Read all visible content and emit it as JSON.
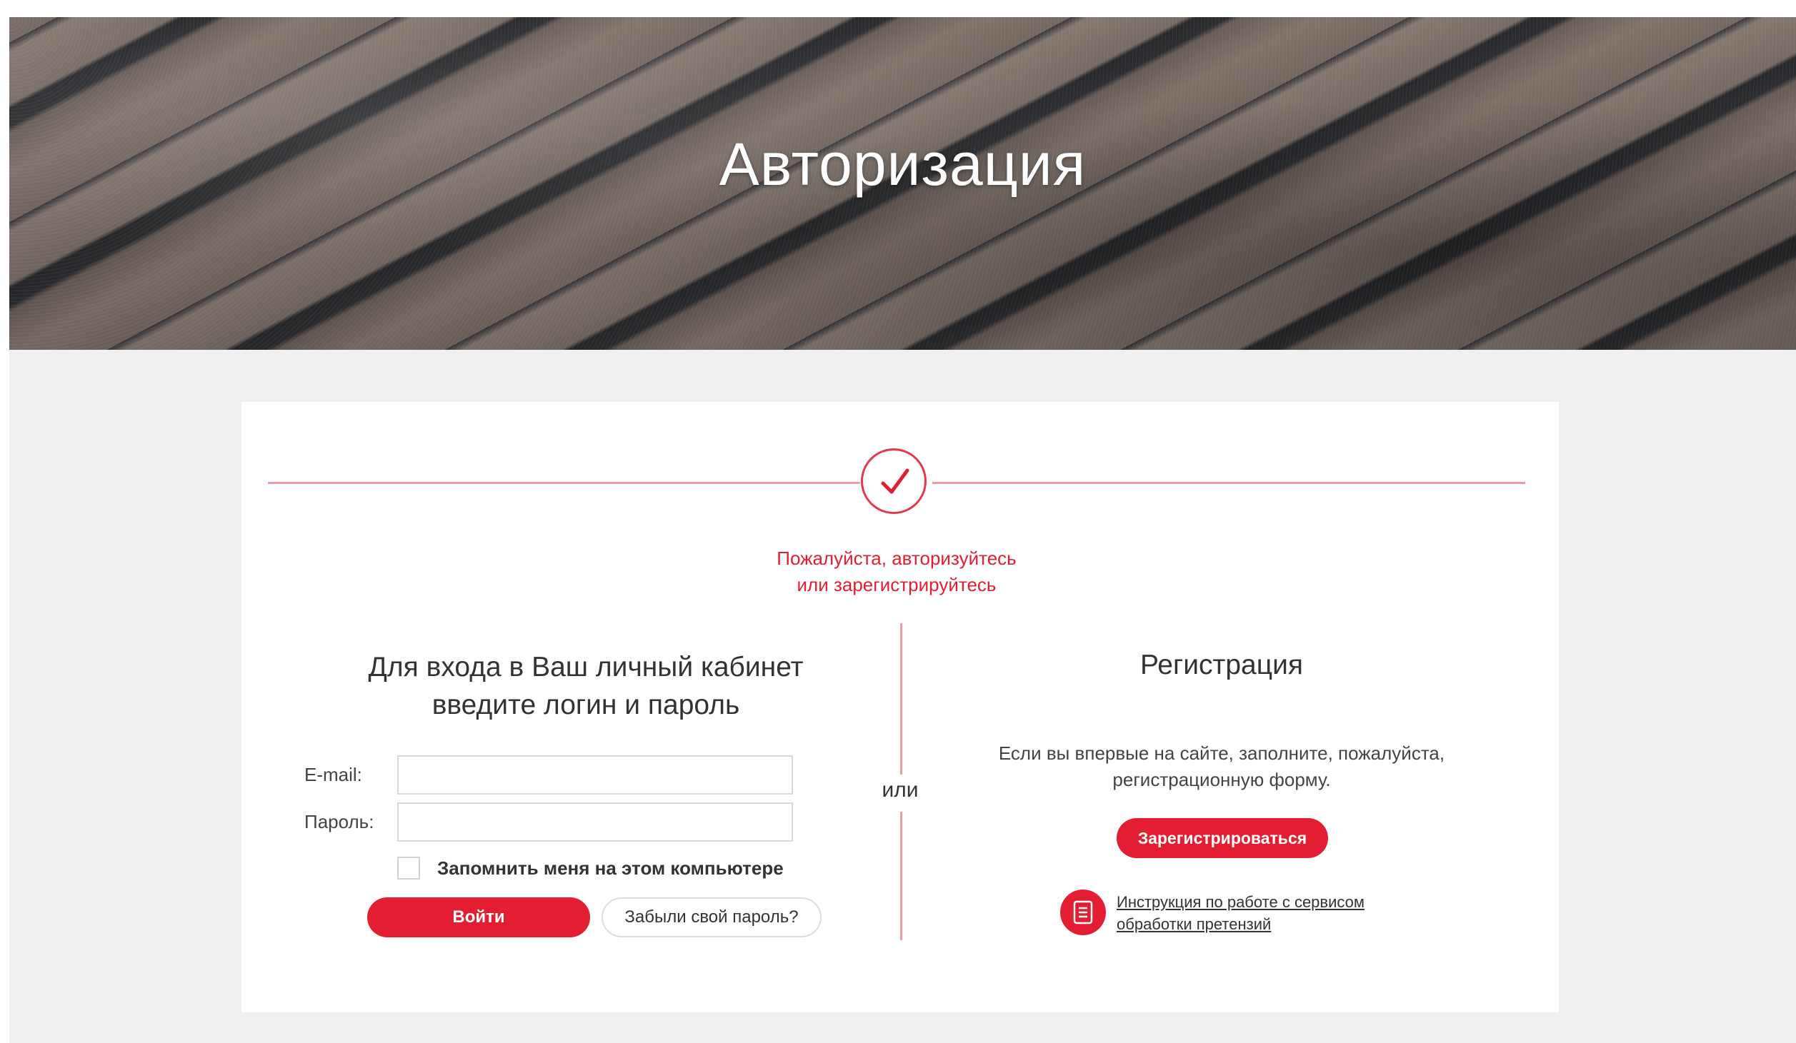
{
  "hero": {
    "title": "Авторизация"
  },
  "prompt": {
    "line1": "Пожалуйста, авторизуйтесь",
    "line2": "или зарегистрируйтесь"
  },
  "login": {
    "title_line1": "Для входа в Ваш личный кабинет",
    "title_line2": "введите логин и пароль",
    "email_label": "E-mail:",
    "email_value": "",
    "password_label": "Пароль:",
    "password_value": "",
    "remember_label": "Запомнить меня на этом компьютере",
    "submit_label": "Войти",
    "forgot_label": "Забыли свой пароль?"
  },
  "separator": {
    "or_label": "или"
  },
  "register": {
    "title": "Регистрация",
    "desc_line1": "Если вы впервые на сайте, заполните, пожалуйста,",
    "desc_line2": "регистрационную форму.",
    "button_label": "Зарегистрироваться",
    "instruction_line1": "Инструкция по работе с сервисом",
    "instruction_line2": "обработки претензий"
  },
  "icons": {
    "check": "checkmark-icon",
    "document": "document-icon"
  },
  "colors": {
    "accent": "#e31e32",
    "accent_light": "#ef9aa4",
    "background": "#f0f0f0",
    "card": "#ffffff"
  }
}
